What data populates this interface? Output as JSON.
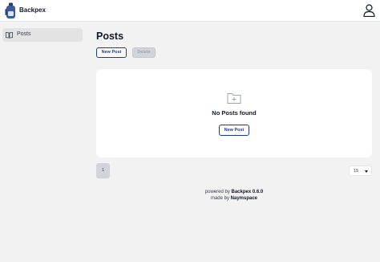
{
  "app": {
    "name": "Backpex"
  },
  "sidebar": {
    "items": [
      {
        "label": "Posts",
        "icon": "book-icon"
      }
    ]
  },
  "main": {
    "title": "Posts",
    "toolbar": {
      "new_label": "New Post",
      "delete_label": "Delete"
    },
    "empty_state": {
      "icon": "folder-plus-icon",
      "message": "No Posts found",
      "button_label": "New Post"
    },
    "pagination": {
      "current_page": "1"
    },
    "per_page": {
      "value": "15"
    }
  },
  "footer": {
    "powered_prefix": "powered by ",
    "powered_name": "Backpex 0.6.0",
    "made_prefix": "made by ",
    "made_name": "Naymspace"
  },
  "colors": {
    "accent": "#1e3a8a",
    "background": "#f2f2f3",
    "card": "#ffffff",
    "sidebar_active": "#e3e3e4"
  }
}
